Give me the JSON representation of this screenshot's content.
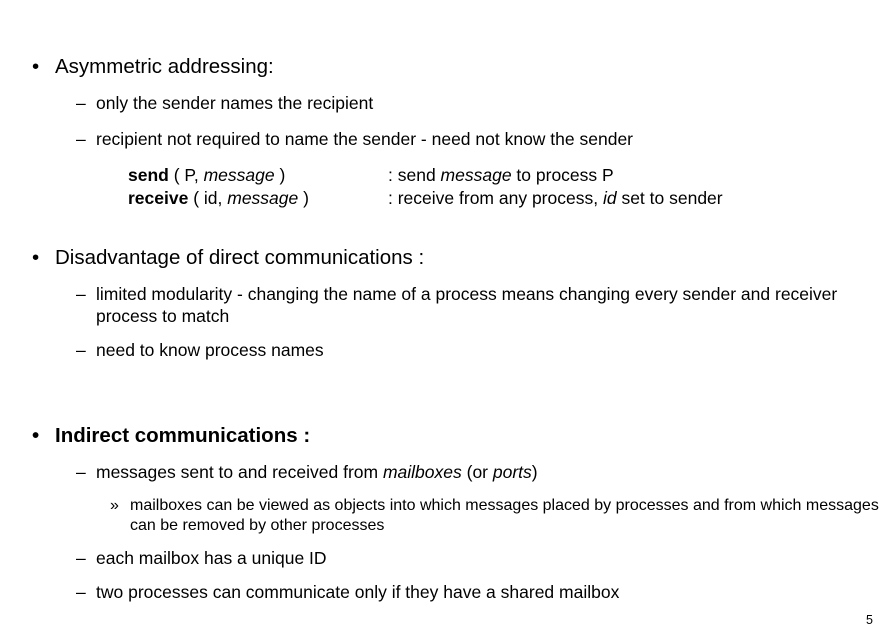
{
  "slide": {
    "page_number": "5",
    "bullet_marker": "•",
    "dash_marker": "–",
    "guillemet_marker": "»",
    "blocks": [
      {
        "id": "asymmetric-addressing",
        "level": 1,
        "bold": false,
        "text": "Asymmetric addressing:"
      },
      {
        "id": "only-sender-names-recipient",
        "level": 2,
        "text": "only the sender names the recipient"
      },
      {
        "id": "recipient-not-required",
        "level": 2,
        "text": "recipient not required to name the sender - need not know the sender"
      },
      {
        "id": "disadvantage-direct-communications",
        "level": 1,
        "bold": false,
        "text": "Disadvantage of direct communications :"
      },
      {
        "id": "limited-modularity",
        "level": 2,
        "text": "limited modularity - changing the name of a process means changing every sender and receiver process to match"
      },
      {
        "id": "need-to-know-process-names",
        "level": 2,
        "text": "need to know process names"
      },
      {
        "id": "indirect-communications",
        "level": 1,
        "bold": true,
        "text": "Indirect communications :"
      },
      {
        "id": "messages-sent-received-mailboxes",
        "level": 2,
        "text": "messages sent to and received from mailboxes (or ports)"
      },
      {
        "id": "mailboxes-viewed-as-objects",
        "level": 3,
        "text": "mailboxes can be viewed as objects into which messages placed by processes and from which messages can be removed by other processes"
      },
      {
        "id": "each-mailbox-unique-id",
        "level": 2,
        "text": "each mailbox has a unique ID"
      },
      {
        "id": "two-processes-shared-mailbox",
        "level": 2,
        "text": "two processes can communicate only if they have a shared mailbox"
      }
    ],
    "api_block": {
      "rows": [
        {
          "id": "send",
          "keyword": "send",
          "signature_open": " ( P, ",
          "signature_italic": "message",
          "signature_close": " )",
          "desc_prefix": ": send ",
          "desc_italic": "message",
          "desc_suffix": " to process P"
        },
        {
          "id": "receive",
          "keyword": "receive",
          "signature_open": " ( id, ",
          "signature_italic": "message",
          "signature_close": " )",
          "desc_prefix": ": receive from any process, ",
          "desc_italic": "id",
          "desc_suffix": " set to sender"
        }
      ]
    },
    "inline_italics": {
      "messages_line_italic_1": "mailboxes",
      "messages_line_italic_2": "ports"
    }
  }
}
